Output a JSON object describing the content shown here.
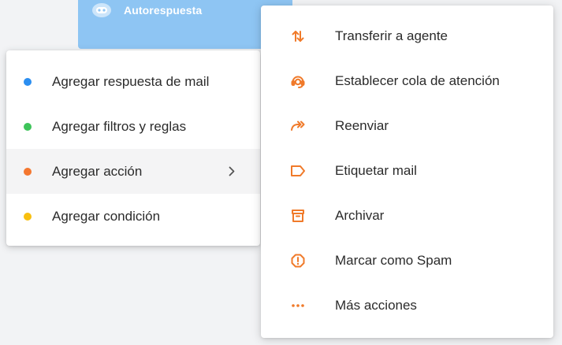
{
  "node": {
    "title": "Autorespuesta",
    "icon": "bot-icon",
    "color": "#8ec5f3"
  },
  "left_menu": {
    "items": [
      {
        "label": "Agregar respuesta de mail",
        "dot_color": "#2b8ef0"
      },
      {
        "label": "Agregar filtros y reglas",
        "dot_color": "#3ec45a"
      },
      {
        "label": "Agregar acción",
        "dot_color": "#f4772f",
        "active": true,
        "has_submenu": true
      },
      {
        "label": "Agregar condición",
        "dot_color": "#f8bf0f"
      }
    ]
  },
  "submenu": {
    "accent_color": "#f07a2a",
    "items": [
      {
        "label": "Transferir a agente",
        "icon": "transfer-arrows-icon"
      },
      {
        "label": "Establecer cola de atención",
        "icon": "headset-agent-icon"
      },
      {
        "label": "Reenviar",
        "icon": "forward-arrow-icon"
      },
      {
        "label": "Etiquetar mail",
        "icon": "tag-label-icon"
      },
      {
        "label": "Archivar",
        "icon": "archive-box-icon"
      },
      {
        "label": "Marcar como Spam",
        "icon": "spam-alert-icon"
      },
      {
        "label": "Más acciones",
        "icon": "more-dots-icon"
      }
    ]
  }
}
